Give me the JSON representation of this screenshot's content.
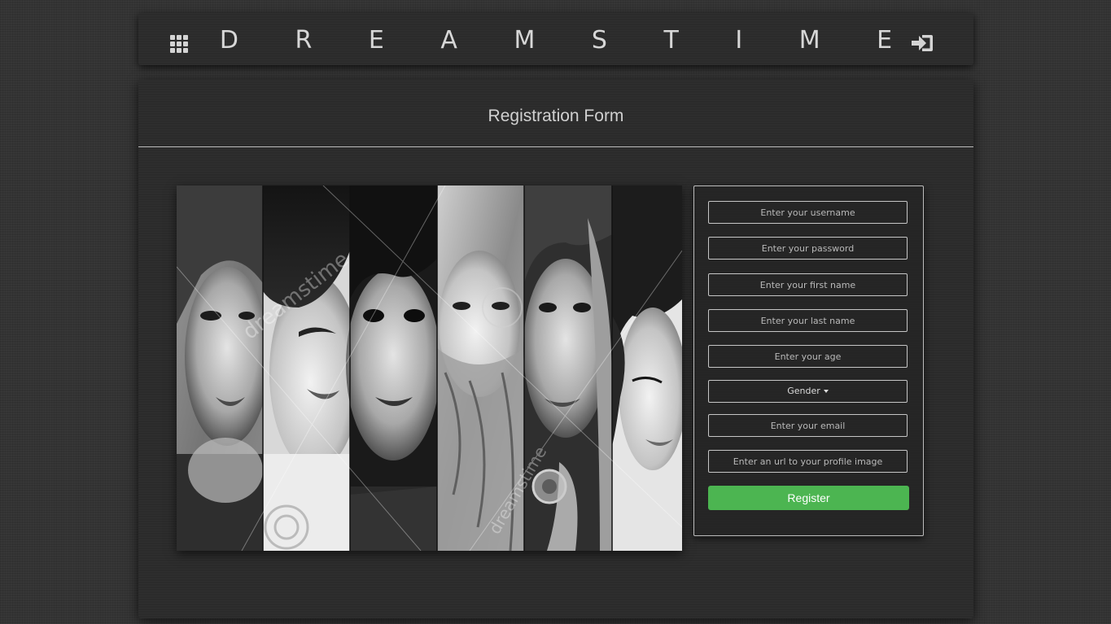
{
  "navbar": {
    "brand": "D R E A M S T I M E",
    "menu_icon": "grid-icon",
    "login_icon": "sign-in-icon"
  },
  "panel": {
    "title": "Registration Form"
  },
  "hero": {
    "watermark": "dreamstime"
  },
  "form": {
    "fields": [
      {
        "name": "username",
        "placeholder": "Enter your username",
        "value": ""
      },
      {
        "name": "password",
        "placeholder": "Enter your password",
        "value": ""
      },
      {
        "name": "first_name",
        "placeholder": "Enter your first name",
        "value": ""
      },
      {
        "name": "last_name",
        "placeholder": "Enter your last name",
        "value": ""
      },
      {
        "name": "age",
        "placeholder": "Enter your age",
        "value": ""
      }
    ],
    "gender_label": "Gender",
    "email_placeholder": "Enter your email",
    "profile_image_placeholder": "Enter an url to your profile image",
    "register_label": "Register"
  },
  "colors": {
    "background": "#333333",
    "panel": "#2b2b2b",
    "accent": "#4cb551",
    "text": "#d7d7d7"
  }
}
